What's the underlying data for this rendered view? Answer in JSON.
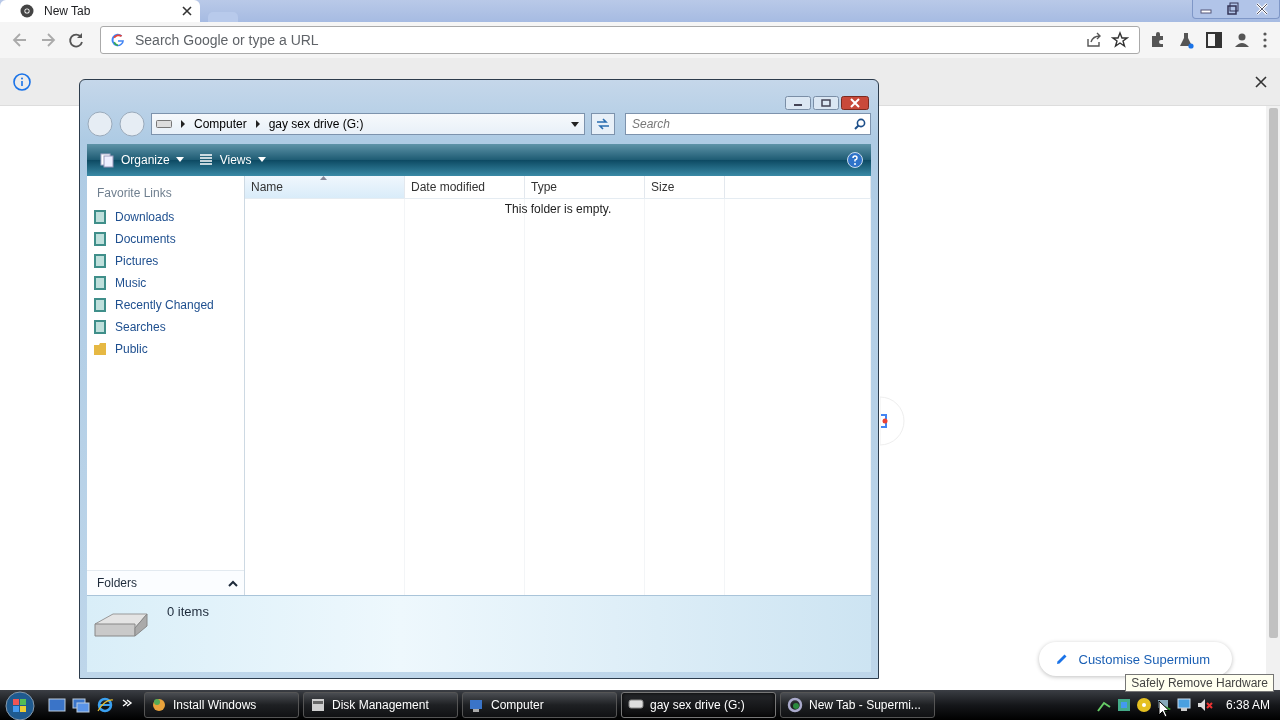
{
  "browser": {
    "tab": {
      "title": "New Tab"
    },
    "omnibox": {
      "placeholder": "Search Google or type a URL"
    },
    "customise_button": "Customise Supermium"
  },
  "explorer": {
    "breadcrumb": [
      "Computer",
      "gay sex drive (G:)"
    ],
    "search": {
      "placeholder": "Search"
    },
    "toolbar": [
      "Organize",
      "Views"
    ],
    "favorite_links_title": "Favorite Links",
    "favorite_links": [
      {
        "label": "Downloads",
        "kind": "library"
      },
      {
        "label": "Documents",
        "kind": "library"
      },
      {
        "label": "Pictures",
        "kind": "library"
      },
      {
        "label": "Music",
        "kind": "library"
      },
      {
        "label": "Recently Changed",
        "kind": "library"
      },
      {
        "label": "Searches",
        "kind": "library"
      },
      {
        "label": "Public",
        "kind": "folder"
      }
    ],
    "columns": [
      {
        "label": "Name",
        "sorted": true
      },
      {
        "label": "Date modified",
        "sorted": false
      },
      {
        "label": "Type",
        "sorted": false
      },
      {
        "label": "Size",
        "sorted": false
      }
    ],
    "empty_message": "This folder is empty.",
    "folders_label": "Folders",
    "item_count": "0 items"
  },
  "taskbar": {
    "buttons": [
      {
        "label": "Install Windows",
        "selected": false
      },
      {
        "label": "Disk Management",
        "selected": false
      },
      {
        "label": "Computer",
        "selected": false
      },
      {
        "label": "gay sex drive (G:)",
        "selected": true
      },
      {
        "label": "New Tab - Supermi...",
        "selected": false
      }
    ],
    "clock": "6:38 AM",
    "tooltip": "Safely Remove Hardware"
  }
}
